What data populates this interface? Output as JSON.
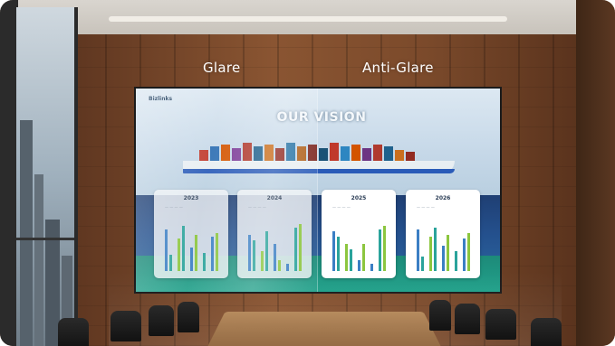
{
  "labels": {
    "left": "Glare",
    "right": "Anti-Glare"
  },
  "screen": {
    "logo": "Bizlinks",
    "headline": "OUR VISION",
    "cards": [
      {
        "year": "2023",
        "legend": "— — — —"
      },
      {
        "year": "2024",
        "legend": "— — — —"
      },
      {
        "year": "2025",
        "legend": "— — — —"
      },
      {
        "year": "2026",
        "legend": "— — — —"
      }
    ]
  },
  "colors": {
    "teal_bar": "#2aa39b",
    "green_bar": "#8cc63f",
    "blue_bar": "#3b7fc4",
    "shore": "#21a18a"
  }
}
